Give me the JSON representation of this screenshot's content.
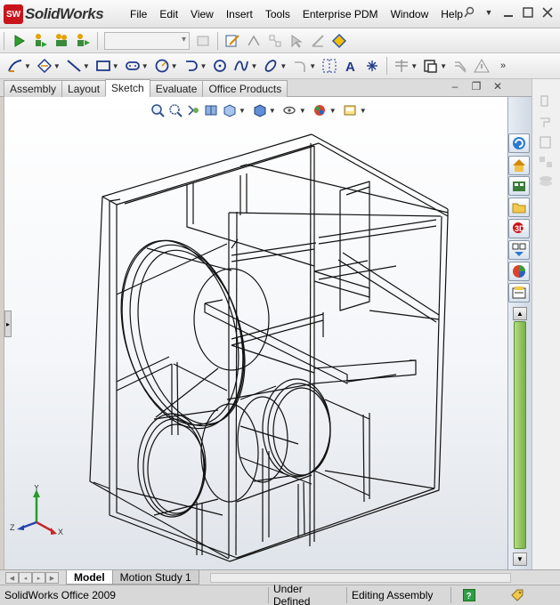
{
  "app": {
    "logo_prefix": "SW",
    "logo_text": "SolidWorks"
  },
  "menu": {
    "items": [
      "File",
      "Edit",
      "View",
      "Insert",
      "Tools",
      "Enterprise PDM",
      "Window",
      "Help"
    ]
  },
  "window_controls": {
    "pin_icon": "pin-icon",
    "minimize_icon": "minimize-icon",
    "restore_icon": "restore-icon",
    "close_icon": "close-icon"
  },
  "toolbar1": {
    "icons": [
      "play-green-icon",
      "person-run-icon",
      "person-group-icon",
      "person-group-2-icon"
    ],
    "config_value": "",
    "right_icons": [
      "sketch-edit-icon",
      "smart-dimension-icon",
      "relation-icon",
      "cursor-icon",
      "measure-icon",
      "quick-snap-icon"
    ]
  },
  "toolbar2": {
    "icons": [
      "sketch-icon",
      "smart-dimension-icon",
      "line-icon",
      "rectangle-icon",
      "slot-icon",
      "circle-icon",
      "arc-icon",
      "polygon-icon",
      "spline-icon",
      "ellipse-icon",
      "fillet-icon",
      "construction-grid-icon",
      "text-icon",
      "point-icon",
      "centerline-icon",
      "offset-icon",
      "mirror-icon",
      "warning-icon",
      "more-icon"
    ]
  },
  "command_tabs": {
    "tabs": [
      "Assembly",
      "Layout",
      "Sketch",
      "Evaluate",
      "Office Products"
    ],
    "active": "Sketch"
  },
  "heads_up": {
    "icons": [
      "zoom-to-fit-icon",
      "zoom-area-icon",
      "previous-view-icon",
      "section-view-icon",
      "view-orientation-icon",
      "display-style-icon",
      "hide-show-icon",
      "appearance-icon",
      "scene-icon"
    ]
  },
  "task_pane": {
    "icons": [
      "resources-icon",
      "design-library-icon",
      "file-explorer-icon",
      "search-icon",
      "view-palette-icon",
      "appearances-icon",
      "custom-properties-icon",
      "toolbox-icon"
    ],
    "disabled_icons": [
      "rotate-icon",
      "pan-icon",
      "zoom-icon",
      "select-icon",
      "layers-icon"
    ]
  },
  "triad": {
    "x_label": "X",
    "y_label": "Y",
    "z_label": "Z"
  },
  "bottom_tabs": {
    "tabs": [
      "Model",
      "Motion Study 1"
    ],
    "active": "Model"
  },
  "status": {
    "product": "SolidWorks Office 2009",
    "defined": "Under Defined",
    "editing": "Editing Assembly",
    "help_icon": "help-icon",
    "tag_icon": "tag-icon"
  },
  "colors": {
    "accent_red": "#c8141a",
    "scroll_green": "#7ab145"
  }
}
